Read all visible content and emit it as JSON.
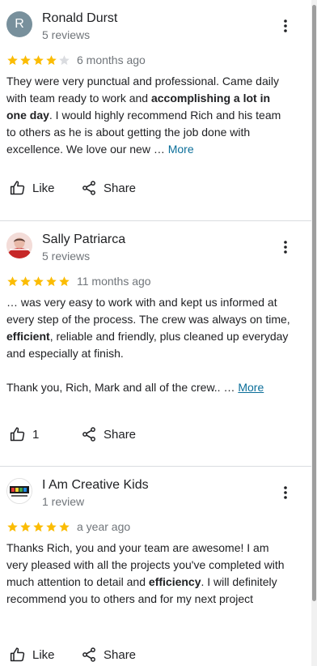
{
  "reviews": [
    {
      "avatar_letter": "R",
      "name": "Ronald Durst",
      "review_count": "5 reviews",
      "rating": 4,
      "age": "6 months ago",
      "text_a": "They were very punctual and professional. Came daily with team ready to work and ",
      "text_bold": "accomplishing a lot in one day",
      "text_b": ". I would highly recommend Rich and his team to others as he is about getting the job done with excellence. We love our new … ",
      "more": "More",
      "like_label": "Like",
      "share_label": "Share"
    },
    {
      "name": "Sally Patriarca",
      "review_count": "5 reviews",
      "rating": 5,
      "age": "11 months ago",
      "text_a": "… was very easy to work with and kept us informed at every step of the process.  The crew was always on time, ",
      "text_bold": "efficient",
      "text_b": ", reliable and friendly, plus cleaned up everyday and especially at finish.",
      "text_c": "Thank you, Rich, Mark and all of the crew.. … ",
      "more": "More",
      "like_count": "1",
      "share_label": "Share"
    },
    {
      "name": "I Am Creative Kids",
      "review_count": "1 review",
      "rating": 5,
      "age": "a year ago",
      "text_a": "Thanks Rich, you and your team are awesome! I am very pleased with all the projects you've completed with much attention to detail and ",
      "text_bold": "efficiency",
      "text_b": ". I will definitely recommend you to others and for my next project",
      "like_label": "Like",
      "share_label": "Share"
    }
  ],
  "colors": {
    "star_filled": "#fbbc04",
    "star_empty": "#dadce0",
    "link": "#0b6e99",
    "avatar_letter_bg": "#78909c"
  },
  "icons": {
    "more": "more-vert-icon",
    "like": "thumb-up-icon",
    "share": "share-icon",
    "star": "star-icon"
  }
}
